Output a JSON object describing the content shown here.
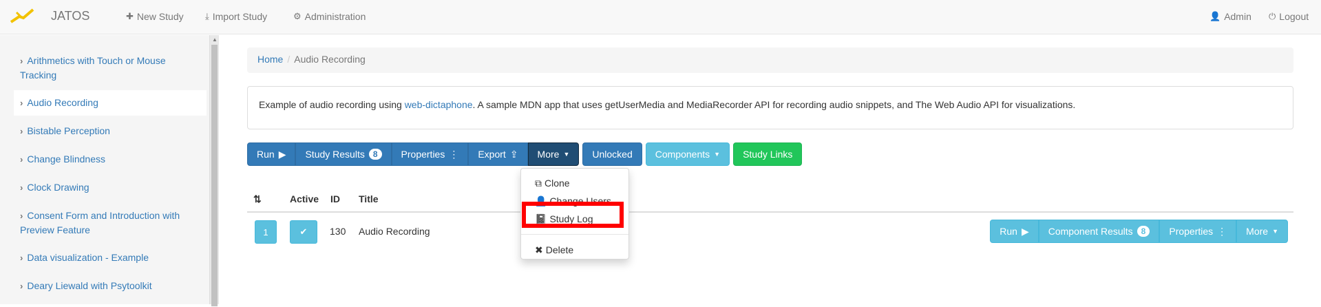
{
  "navbar": {
    "brand": "JATOS",
    "new_study": "New Study",
    "import_study": "Import Study",
    "administration": "Administration",
    "admin": "Admin",
    "logout": "Logout"
  },
  "sidebar": {
    "items": [
      {
        "label": "Arithmetics with Touch or Mouse Tracking"
      },
      {
        "label": "Audio Recording"
      },
      {
        "label": "Bistable Perception"
      },
      {
        "label": "Change Blindness"
      },
      {
        "label": "Clock Drawing"
      },
      {
        "label": "Consent Form and Introduction with Preview Feature"
      },
      {
        "label": "Data visualization - Example"
      },
      {
        "label": "Deary Liewald with Psytoolkit"
      }
    ]
  },
  "breadcrumb": {
    "home": "Home",
    "current": "Audio Recording"
  },
  "description": {
    "before": "Example of audio recording using ",
    "link": "web-dictaphone",
    "after": ". A sample MDN app that uses getUserMedia and MediaRecorder API for recording audio snippets, and The Web Audio API for visualizations."
  },
  "toolbar": {
    "run": "Run",
    "study_results": "Study Results",
    "study_results_count": "8",
    "properties": "Properties",
    "export": "Export",
    "more": "More",
    "unlocked": "Unlocked",
    "components": "Components",
    "study_links": "Study Links"
  },
  "more_menu": {
    "clone": "Clone",
    "change_users": "Change Users",
    "study_log": "Study Log",
    "delete": "Delete"
  },
  "table": {
    "headers": {
      "active": "Active",
      "id": "ID",
      "title": "Title"
    },
    "rows": [
      {
        "position": "1",
        "id": "130",
        "title": "Audio Recording",
        "run": "Run",
        "component_results": "Component Results",
        "component_results_count": "8",
        "properties": "Properties",
        "more": "More"
      }
    ]
  }
}
